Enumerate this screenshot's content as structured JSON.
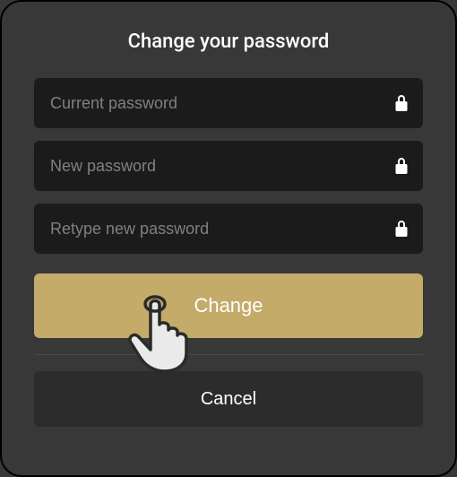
{
  "title": "Change your password",
  "fields": {
    "current": {
      "placeholder": "Current password"
    },
    "new": {
      "placeholder": "New password"
    },
    "retype": {
      "placeholder": "Retype new password"
    }
  },
  "buttons": {
    "change": "Change",
    "cancel": "Cancel"
  }
}
